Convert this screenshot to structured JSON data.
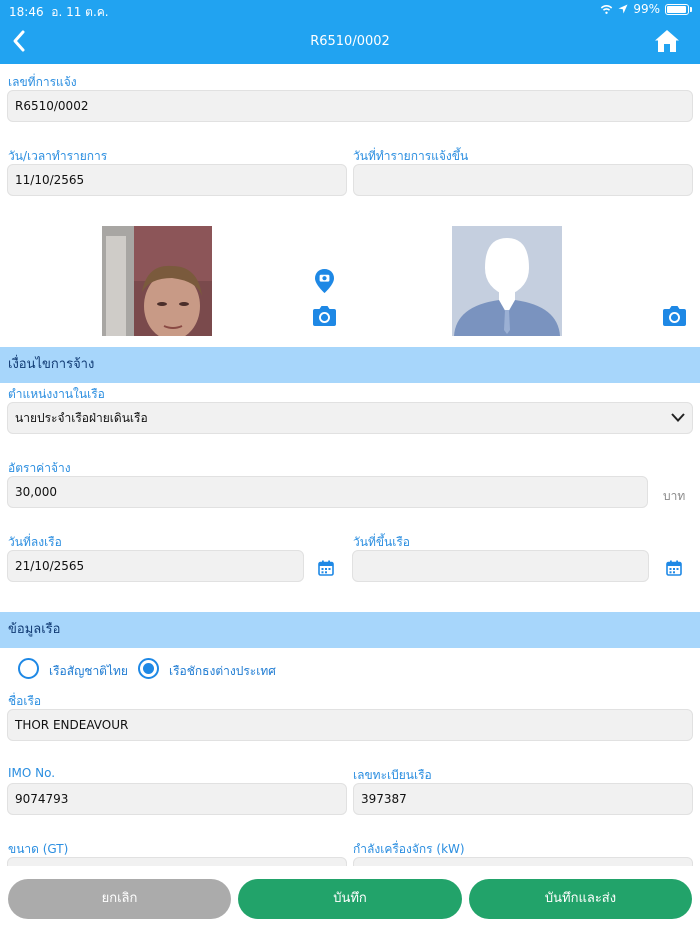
{
  "status_bar": {
    "time": "18:46",
    "date": "อ. 11 ต.ค.",
    "battery": "99%",
    "icons": [
      "wifi-icon",
      "location-arrow-icon",
      "battery-icon"
    ]
  },
  "header": {
    "title": "R6510/0002",
    "back_icon": "chevron-left-icon",
    "home_icon": "home-icon",
    "color": "#21a3f1"
  },
  "report": {
    "report_no_label": "เลขที่การแจ้ง",
    "report_no_value": "R6510/0002",
    "transaction_date_label": "วัน/เวลาทำรายการ",
    "transaction_date_value": "11/10/2565",
    "notification_date_label": "วันที่ทำรายการแจ้งขึ้น",
    "notification_date_value": ""
  },
  "photos": {
    "pin_camera_icon": "map-pin-camera-icon",
    "camera_icon": "camera-icon"
  },
  "employment": {
    "section_title": "เงื่อนไขการจ้าง",
    "position_label": "ตำแหน่งงานในเรือ",
    "position_value": "นายประจำเรือฝ่ายเดินเรือ",
    "wage_label": "อัตราค่าจ้าง",
    "wage_value": "30,000",
    "wage_unit": "บาท",
    "board_date_label": "วันที่ลงเรือ",
    "board_date_value": "21/10/2565",
    "disembark_date_label": "วันที่ขึ้นเรือ",
    "disembark_date_value": ""
  },
  "vessel": {
    "section_title": "ข้อมูลเรือ",
    "radio_thai": "เรือสัญชาติไทย",
    "radio_foreign": "เรือชักธงต่างประเทศ",
    "selected": "foreign",
    "name_label": "ชื่อเรือ",
    "name_value": "THOR ENDEAVOUR",
    "imo_label": "IMO No.",
    "imo_value": "9074793",
    "registration_label": "เลขทะเบียนเรือ",
    "registration_value": "397387",
    "size_label": "ขนาด (GT)",
    "engine_power_label": "กำลังเครื่องจักร (kW)"
  },
  "actions": {
    "cancel": "ยกเลิก",
    "save": "บันทึก",
    "save_and_send": "บันทึกและส่ง",
    "cancel_color": "#ababab",
    "primary_color": "#22a36a"
  }
}
